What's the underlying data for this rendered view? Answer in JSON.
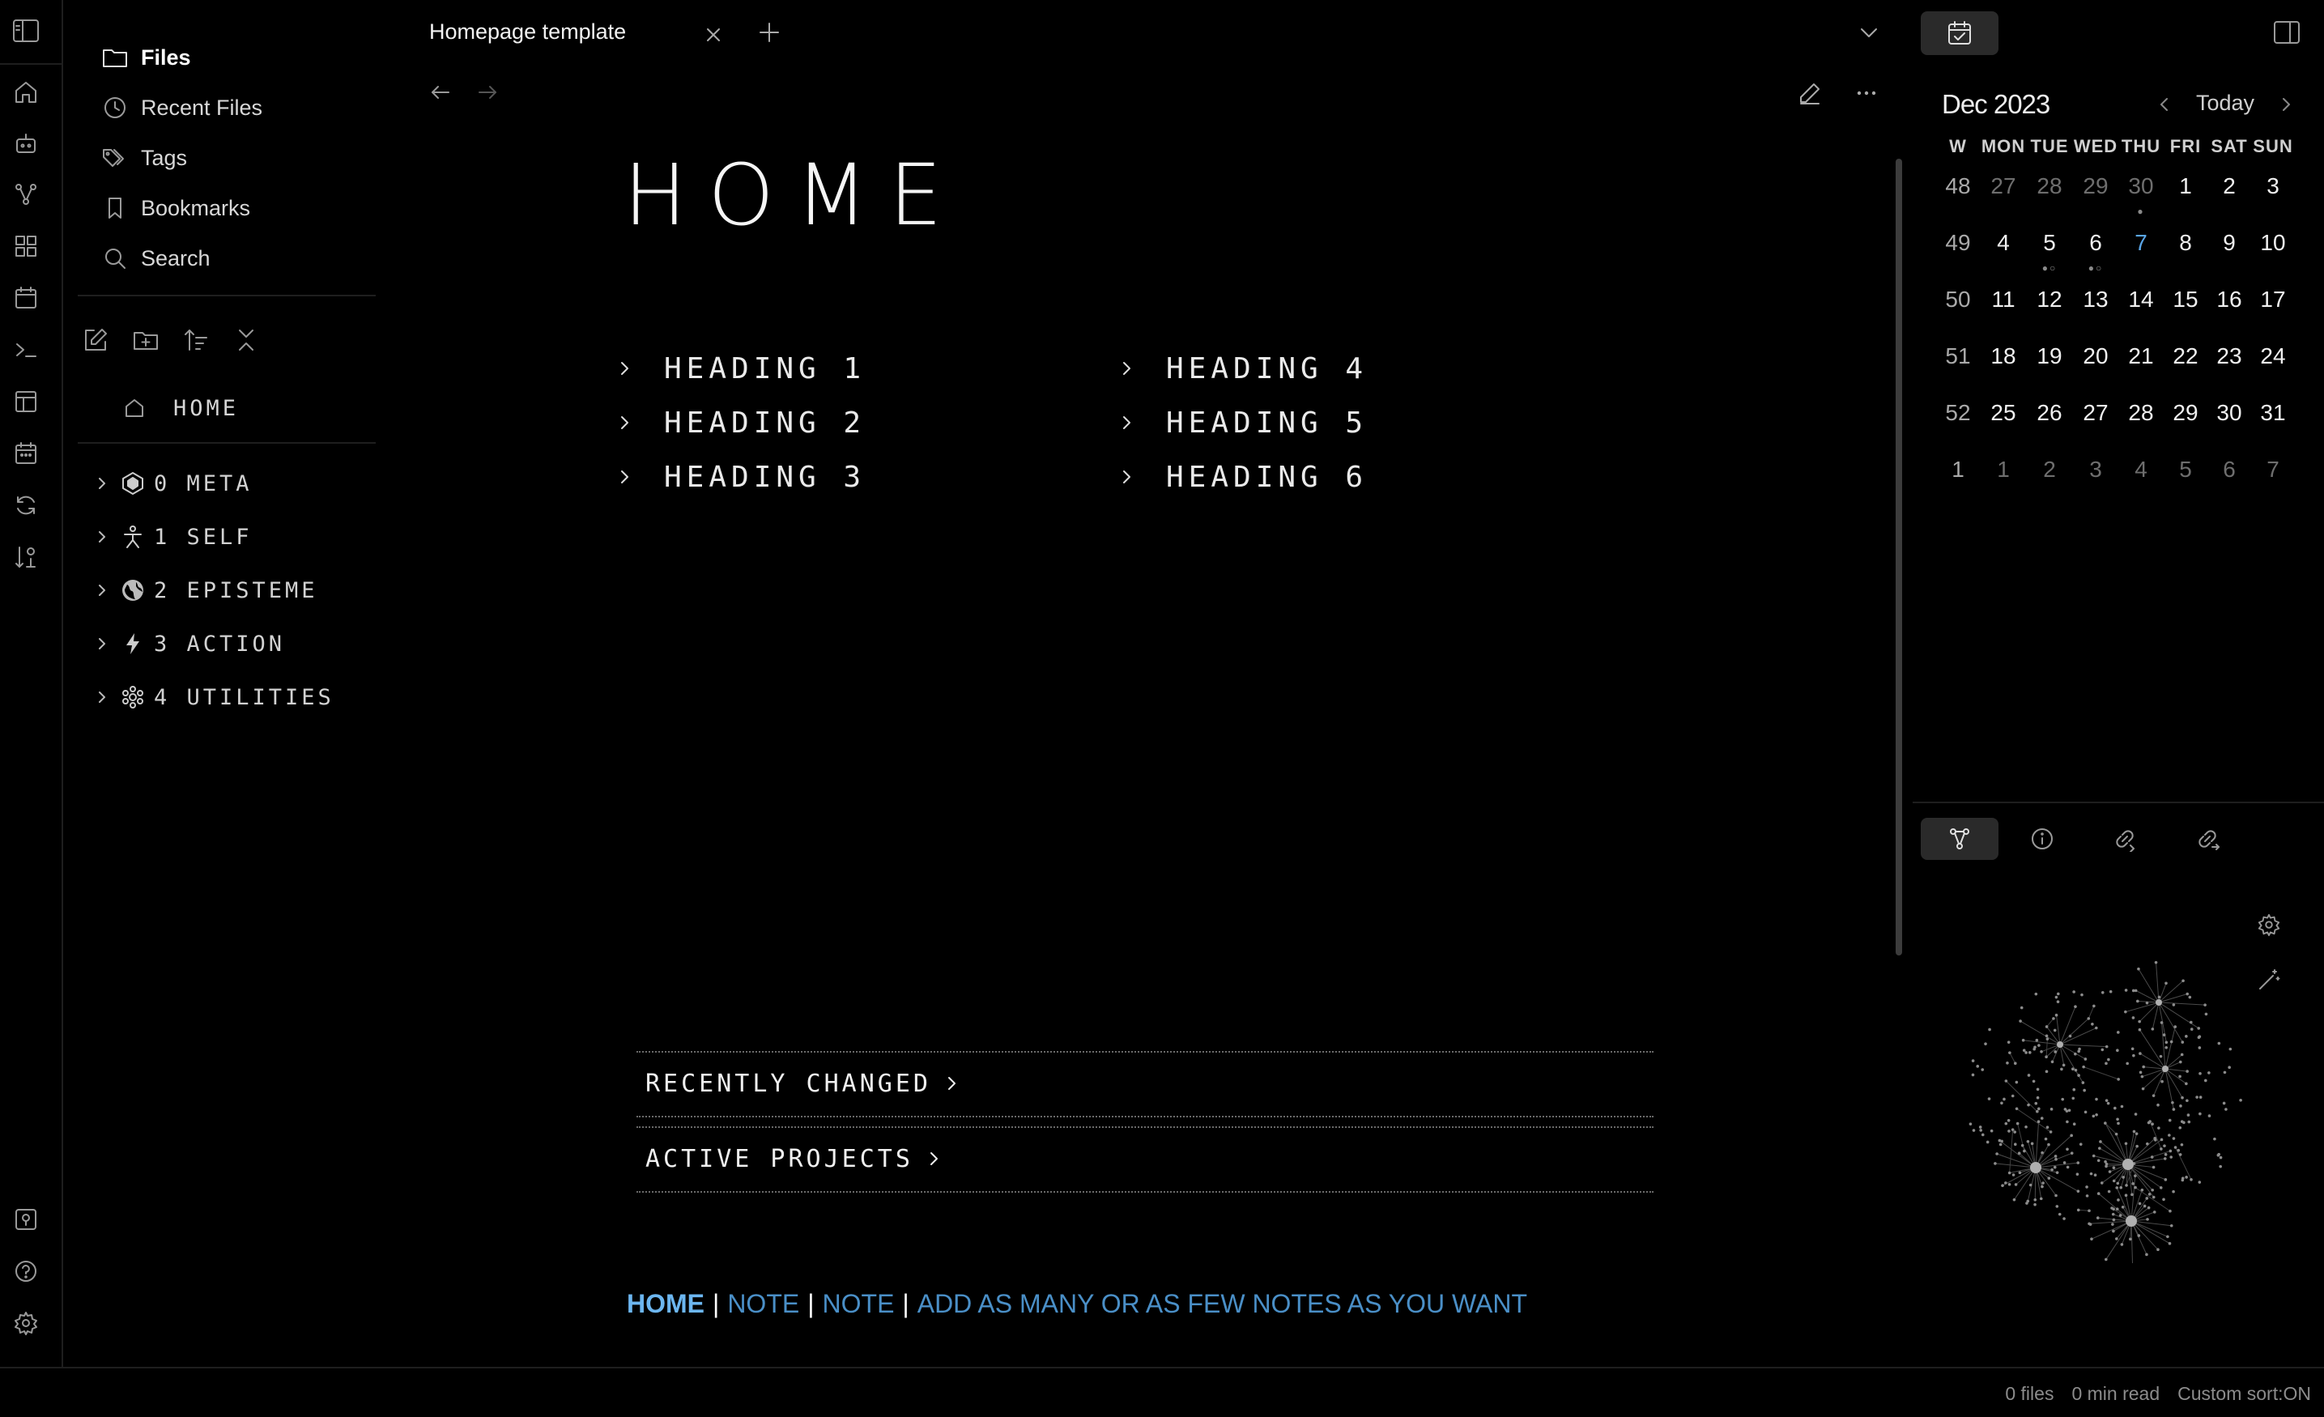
{
  "window": {
    "tab_title": "Homepage template"
  },
  "sidebar": {
    "nav": [
      {
        "label": "Files",
        "icon": "folder-icon"
      },
      {
        "label": "Recent Files",
        "icon": "clock-icon"
      },
      {
        "label": "Tags",
        "icon": "tags-icon"
      },
      {
        "label": "Bookmarks",
        "icon": "bookmark-icon"
      },
      {
        "label": "Search",
        "icon": "search-icon"
      }
    ],
    "home_item": "HOME",
    "folders": [
      {
        "label": "0 META",
        "icon": "hexagon-icon"
      },
      {
        "label": "1 SELF",
        "icon": "person-icon"
      },
      {
        "label": "2 EPISTEME",
        "icon": "globe-icon"
      },
      {
        "label": "3 ACTION",
        "icon": "bolt-icon"
      },
      {
        "label": "4 UTILITIES",
        "icon": "cog-icon"
      }
    ]
  },
  "content": {
    "title": "HOME",
    "headings": [
      "HEADING 1",
      "HEADING 2",
      "HEADING 3",
      "HEADING 4",
      "HEADING 5",
      "HEADING 6"
    ],
    "sections": [
      "RECENTLY CHANGED",
      "ACTIVE PROJECTS"
    ],
    "footer_nav": {
      "current": "HOME",
      "links": [
        "NOTE",
        "NOTE",
        "ADD AS MANY OR AS FEW NOTES AS YOU WANT"
      ],
      "separator": "|"
    }
  },
  "calendar": {
    "month": "Dec 2023",
    "today_label": "Today",
    "weekdays": [
      "W",
      "MON",
      "TUE",
      "WED",
      "THU",
      "FRI",
      "SAT",
      "SUN"
    ],
    "weeks": [
      {
        "week": "48",
        "days": [
          "27",
          "28",
          "29",
          "30",
          "1",
          "2",
          "3"
        ]
      },
      {
        "week": "49",
        "days": [
          "4",
          "5",
          "6",
          "7",
          "8",
          "9",
          "10"
        ]
      },
      {
        "week": "50",
        "days": [
          "11",
          "12",
          "13",
          "14",
          "15",
          "16",
          "17"
        ]
      },
      {
        "week": "51",
        "days": [
          "18",
          "19",
          "20",
          "21",
          "22",
          "23",
          "24"
        ]
      },
      {
        "week": "52",
        "days": [
          "25",
          "26",
          "27",
          "28",
          "29",
          "30",
          "31"
        ]
      },
      {
        "week": "1",
        "days": [
          "1",
          "2",
          "3",
          "4",
          "5",
          "6",
          "7"
        ]
      }
    ],
    "today_date": "7",
    "accent_color": "#5aa6e8"
  },
  "right_panel": {
    "tabs": [
      "graph-icon",
      "info-icon",
      "backlinks-icon",
      "outgoing-links-icon"
    ]
  },
  "status_bar": {
    "files": "0 files",
    "read_time": "0 min read",
    "sort": "Custom sort:ON"
  }
}
